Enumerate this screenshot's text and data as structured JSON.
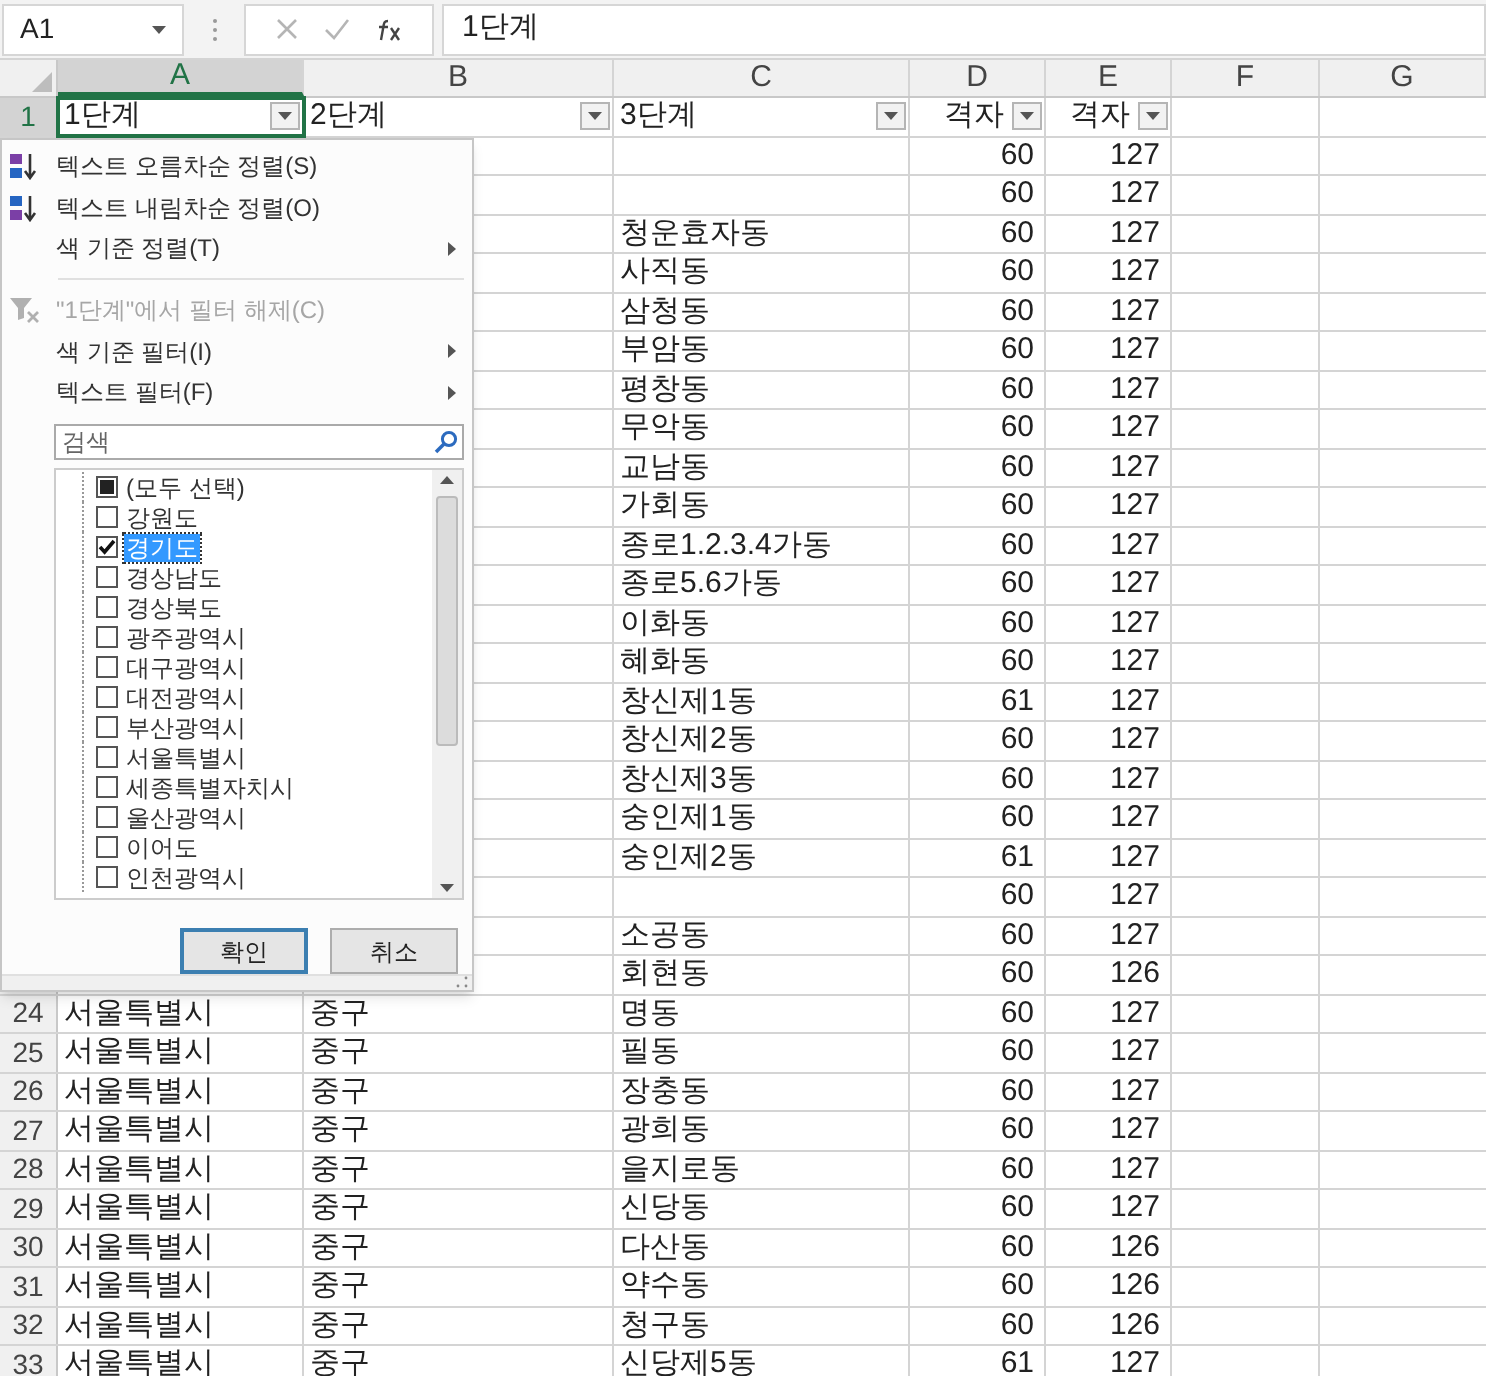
{
  "formula_bar": {
    "name_box": "A1",
    "value": "1단계"
  },
  "columns": [
    {
      "label": "A",
      "selected": true
    },
    {
      "label": "B",
      "selected": false
    },
    {
      "label": "C",
      "selected": false
    },
    {
      "label": "D",
      "selected": false
    },
    {
      "label": "E",
      "selected": false
    },
    {
      "label": "F",
      "selected": false
    },
    {
      "label": "G",
      "selected": false
    }
  ],
  "header_row": {
    "number": "1",
    "selected": true,
    "cells": [
      "1단계",
      "2단계",
      "3단계",
      "격자",
      "격자"
    ]
  },
  "rows": [
    {
      "d": "60",
      "e": "127"
    },
    {
      "d": "60",
      "e": "127"
    },
    {
      "c": "청운효자동",
      "d": "60",
      "e": "127"
    },
    {
      "c": "사직동",
      "d": "60",
      "e": "127"
    },
    {
      "c": "삼청동",
      "d": "60",
      "e": "127"
    },
    {
      "c": "부암동",
      "d": "60",
      "e": "127"
    },
    {
      "c": "평창동",
      "d": "60",
      "e": "127"
    },
    {
      "c": "무악동",
      "d": "60",
      "e": "127"
    },
    {
      "c": "교남동",
      "d": "60",
      "e": "127"
    },
    {
      "c": "가회동",
      "d": "60",
      "e": "127"
    },
    {
      "c": "종로1.2.3.4가동",
      "d": "60",
      "e": "127"
    },
    {
      "c": "종로5.6가동",
      "d": "60",
      "e": "127"
    },
    {
      "c": "이화동",
      "d": "60",
      "e": "127"
    },
    {
      "c": "혜화동",
      "d": "60",
      "e": "127"
    },
    {
      "c": "창신제1동",
      "d": "61",
      "e": "127"
    },
    {
      "c": "창신제2동",
      "d": "60",
      "e": "127"
    },
    {
      "c": "창신제3동",
      "d": "60",
      "e": "127"
    },
    {
      "c": "숭인제1동",
      "d": "60",
      "e": "127"
    },
    {
      "c": "숭인제2동",
      "d": "61",
      "e": "127"
    },
    {
      "d": "60",
      "e": "127"
    },
    {
      "c": "소공동",
      "d": "60",
      "e": "127"
    },
    {
      "c": "회현동",
      "d": "60",
      "e": "126"
    },
    {
      "number": "24",
      "a": "서울특별시",
      "b": "중구",
      "c": "명동",
      "d": "60",
      "e": "127"
    },
    {
      "number": "25",
      "a": "서울특별시",
      "b": "중구",
      "c": "필동",
      "d": "60",
      "e": "127"
    },
    {
      "number": "26",
      "a": "서울특별시",
      "b": "중구",
      "c": "장충동",
      "d": "60",
      "e": "127"
    },
    {
      "number": "27",
      "a": "서울특별시",
      "b": "중구",
      "c": "광희동",
      "d": "60",
      "e": "127"
    },
    {
      "number": "28",
      "a": "서울특별시",
      "b": "중구",
      "c": "을지로동",
      "d": "60",
      "e": "127"
    },
    {
      "number": "29",
      "a": "서울특별시",
      "b": "중구",
      "c": "신당동",
      "d": "60",
      "e": "127"
    },
    {
      "number": "30",
      "a": "서울특별시",
      "b": "중구",
      "c": "다산동",
      "d": "60",
      "e": "126"
    },
    {
      "number": "31",
      "a": "서울특별시",
      "b": "중구",
      "c": "약수동",
      "d": "60",
      "e": "126"
    },
    {
      "number": "32",
      "a": "서울특별시",
      "b": "중구",
      "c": "청구동",
      "d": "60",
      "e": "126"
    },
    {
      "number": "33",
      "a": "서울특별시",
      "b": "중구",
      "c": "신당제5동",
      "d": "61",
      "e": "127"
    }
  ],
  "filter_menu": {
    "items": [
      {
        "kind": "sort-asc",
        "label": "텍스트 오름차순 정렬(S)",
        "disabled": false
      },
      {
        "kind": "sort-desc",
        "label": "텍스트 내림차순 정렬(O)",
        "disabled": false
      },
      {
        "kind": "submenu",
        "label": "색 기준 정렬(T)",
        "disabled": false
      },
      {
        "kind": "divider"
      },
      {
        "kind": "clear-filter",
        "label": "\"1단계\"에서 필터 해제(C)",
        "disabled": true
      },
      {
        "kind": "submenu",
        "label": "색 기준 필터(I)",
        "disabled": false
      },
      {
        "kind": "submenu",
        "label": "텍스트 필터(F)",
        "disabled": false
      }
    ],
    "search": {
      "placeholder": "검색"
    },
    "values": [
      {
        "label": "(모두 선택)",
        "checked": false,
        "partial": true,
        "selected": false
      },
      {
        "label": "강원도",
        "checked": false,
        "partial": false,
        "selected": false
      },
      {
        "label": "경기도",
        "checked": true,
        "partial": false,
        "selected": true
      },
      {
        "label": "경상남도",
        "checked": false,
        "partial": false,
        "selected": false
      },
      {
        "label": "경상북도",
        "checked": false,
        "partial": false,
        "selected": false
      },
      {
        "label": "광주광역시",
        "checked": false,
        "partial": false,
        "selected": false
      },
      {
        "label": "대구광역시",
        "checked": false,
        "partial": false,
        "selected": false
      },
      {
        "label": "대전광역시",
        "checked": false,
        "partial": false,
        "selected": false
      },
      {
        "label": "부산광역시",
        "checked": false,
        "partial": false,
        "selected": false
      },
      {
        "label": "서울특별시",
        "checked": false,
        "partial": false,
        "selected": false
      },
      {
        "label": "세종특별자치시",
        "checked": false,
        "partial": false,
        "selected": false
      },
      {
        "label": "울산광역시",
        "checked": false,
        "partial": false,
        "selected": false
      },
      {
        "label": "이어도",
        "checked": false,
        "partial": false,
        "selected": false
      },
      {
        "label": "인천광역시",
        "checked": false,
        "partial": false,
        "selected": false
      }
    ],
    "buttons": [
      {
        "label": "확인",
        "default": true
      },
      {
        "label": "취소",
        "default": false
      }
    ]
  }
}
